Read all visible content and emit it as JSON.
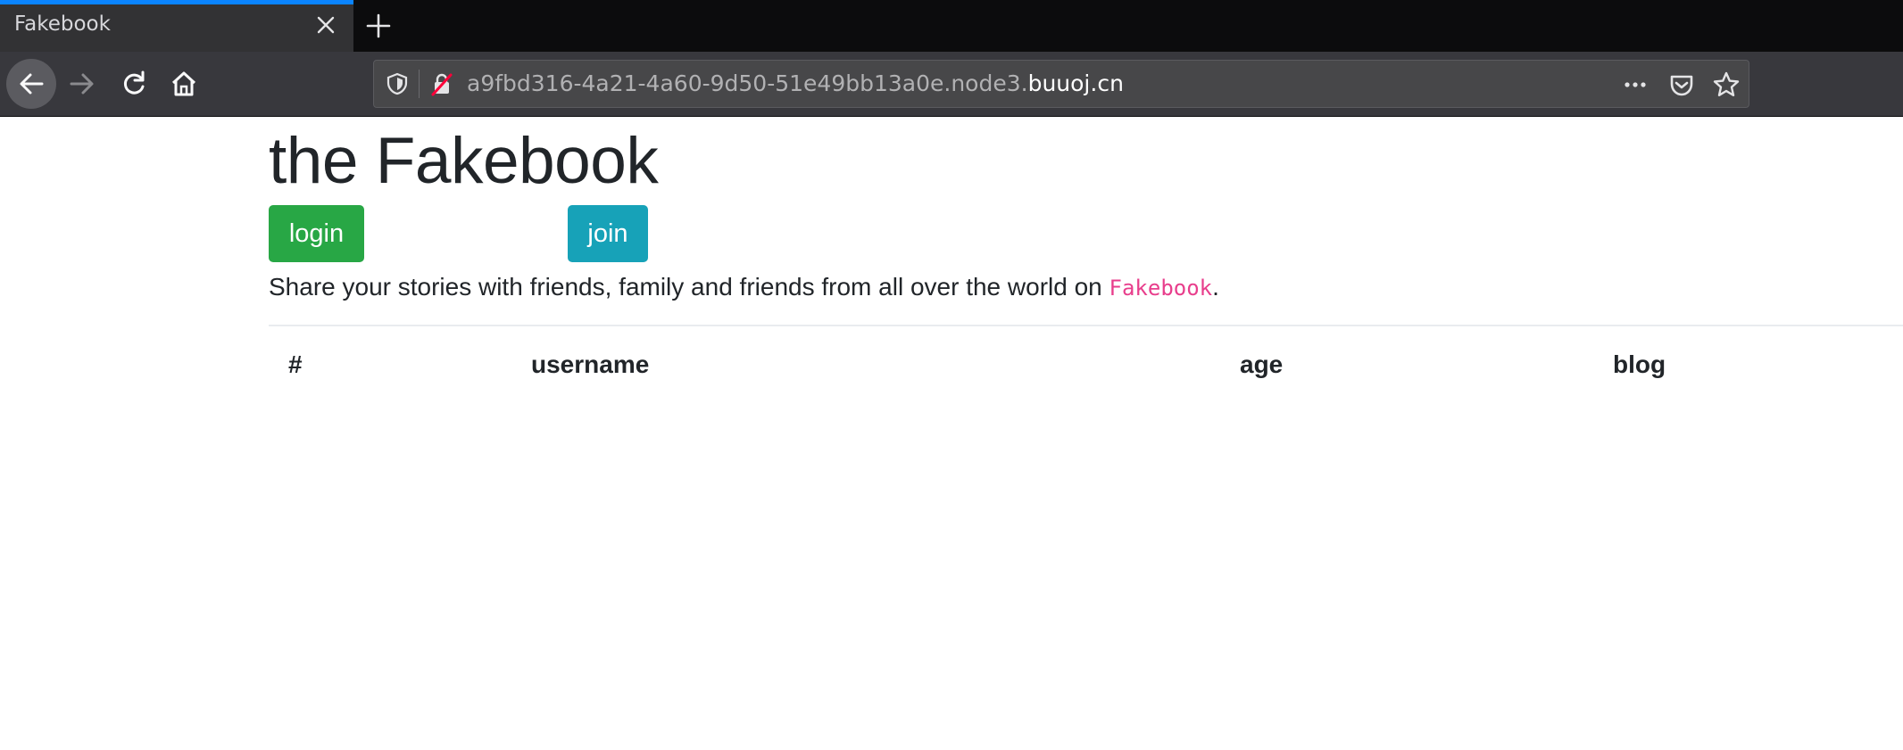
{
  "browser": {
    "tab": {
      "title": "Fakebook"
    },
    "url": {
      "subdomain": "a9fbd316-4a21-4a60-9d50-51e49bb13a0e.node3.",
      "domain": "buuoj.cn"
    },
    "icons": {
      "close": "close-icon",
      "new_tab": "plus-icon",
      "back": "back-arrow-icon",
      "forward": "forward-arrow-icon",
      "reload": "reload-icon",
      "home": "home-icon",
      "shield": "shield-icon",
      "insecure_lock": "insecure-lock-icon",
      "more": "more-dots-icon",
      "pocket": "pocket-icon",
      "bookmark": "star-icon"
    },
    "colors": {
      "tab_accent": "#0a84ff",
      "chrome_dark": "#0c0c0d",
      "toolbar": "#38383d"
    }
  },
  "page": {
    "title": "the Fakebook",
    "buttons": {
      "login": "login",
      "join": "join"
    },
    "lead": {
      "text": "Share your stories with friends, family and friends from all over the world on ",
      "brand": "Fakebook",
      "end": "."
    },
    "table": {
      "headers": [
        "#",
        "username",
        "age",
        "blog"
      ],
      "rows": []
    },
    "colors": {
      "login": "#28a745",
      "join": "#17a2b8",
      "brand": "#e83e8c"
    }
  }
}
